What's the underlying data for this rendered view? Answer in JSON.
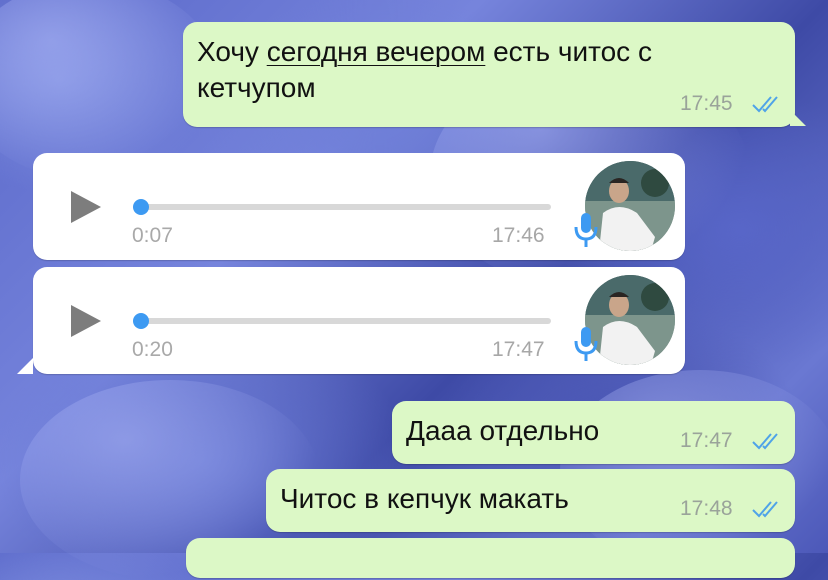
{
  "messages": [
    {
      "type": "outgoing-text",
      "line1_a": "Хочу ",
      "line1_underlined": "сегодня вечером",
      "line1_b": " есть читос с",
      "line2": "кетчупом",
      "time": "17:45"
    },
    {
      "type": "incoming-voice",
      "duration": "0:07",
      "time": "17:46"
    },
    {
      "type": "incoming-voice",
      "duration": "0:20",
      "time": "17:47"
    },
    {
      "type": "outgoing-text",
      "text": "Дааа отдельно",
      "time": "17:47"
    },
    {
      "type": "outgoing-text",
      "text": "Читос в кепчук макать",
      "time": "17:48"
    }
  ],
  "colors": {
    "outgoing_bubble": "#dcf8c6",
    "incoming_bubble": "#ffffff",
    "read_ticks": "#4fa3e8",
    "voice_knob": "#3d9af2"
  },
  "icons": [
    "play-icon",
    "microphone-icon",
    "double-check-icon",
    "avatar-photo"
  ]
}
